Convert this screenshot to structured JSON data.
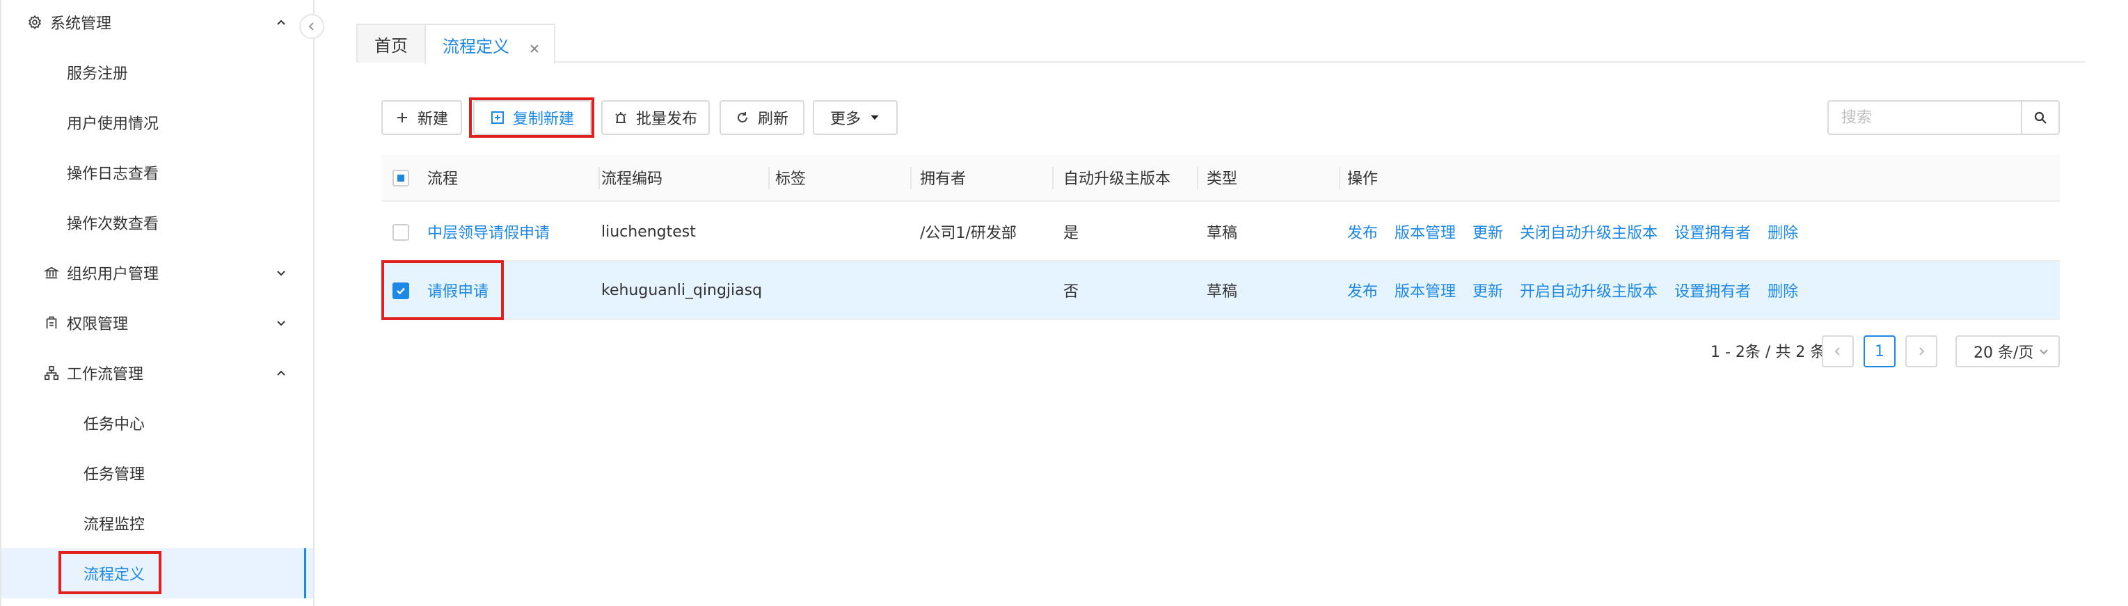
{
  "sidebar": {
    "items": [
      {
        "label": "系统管理",
        "icon": "gear-icon",
        "expanded": true
      },
      {
        "label": "服务注册"
      },
      {
        "label": "用户使用情况"
      },
      {
        "label": "操作日志查看"
      },
      {
        "label": "操作次数查看"
      },
      {
        "label": "组织用户管理",
        "icon": "bank-icon",
        "expanded": false
      },
      {
        "label": "权限管理",
        "icon": "permission-icon",
        "expanded": false
      },
      {
        "label": "工作流管理",
        "icon": "workflow-icon",
        "expanded": true
      },
      {
        "label": "任务中心"
      },
      {
        "label": "任务管理"
      },
      {
        "label": "流程监控"
      },
      {
        "label": "流程定义",
        "active": true
      }
    ]
  },
  "tabs": [
    {
      "label": "首页"
    },
    {
      "label": "流程定义",
      "active": true,
      "closable": true
    }
  ],
  "toolbar": {
    "new_label": "新建",
    "copy_new_label": "复制新建",
    "batch_publish_label": "批量发布",
    "refresh_label": "刷新",
    "more_label": "更多"
  },
  "search": {
    "placeholder": "搜索",
    "value": ""
  },
  "table": {
    "columns": [
      "流程",
      "流程编码",
      "标签",
      "拥有者",
      "自动升级主版本",
      "类型",
      "操作"
    ],
    "rows": [
      {
        "checked": false,
        "name": "中层领导请假申请",
        "code": "liuchengtest",
        "tag": "",
        "owner": "/公司1/研发部",
        "auto_upgrade": "是",
        "type": "草稿",
        "actions": [
          "发布",
          "版本管理",
          "更新",
          "关闭自动升级主版本",
          "设置拥有者",
          "删除"
        ]
      },
      {
        "checked": true,
        "name": "请假申请",
        "code": "kehuguanli_qingjiasq",
        "tag": "",
        "owner": "",
        "auto_upgrade": "否",
        "type": "草稿",
        "actions": [
          "发布",
          "版本管理",
          "更新",
          "开启自动升级主版本",
          "设置拥有者",
          "删除"
        ]
      }
    ]
  },
  "pagination": {
    "total_text": "1 - 2条 / 共 2 条",
    "current_page": "1",
    "page_size": "20 条/页"
  },
  "colors": {
    "accent": "#1e88e5",
    "highlight": "#e0201f",
    "selected_row": "#e6f4ff"
  }
}
